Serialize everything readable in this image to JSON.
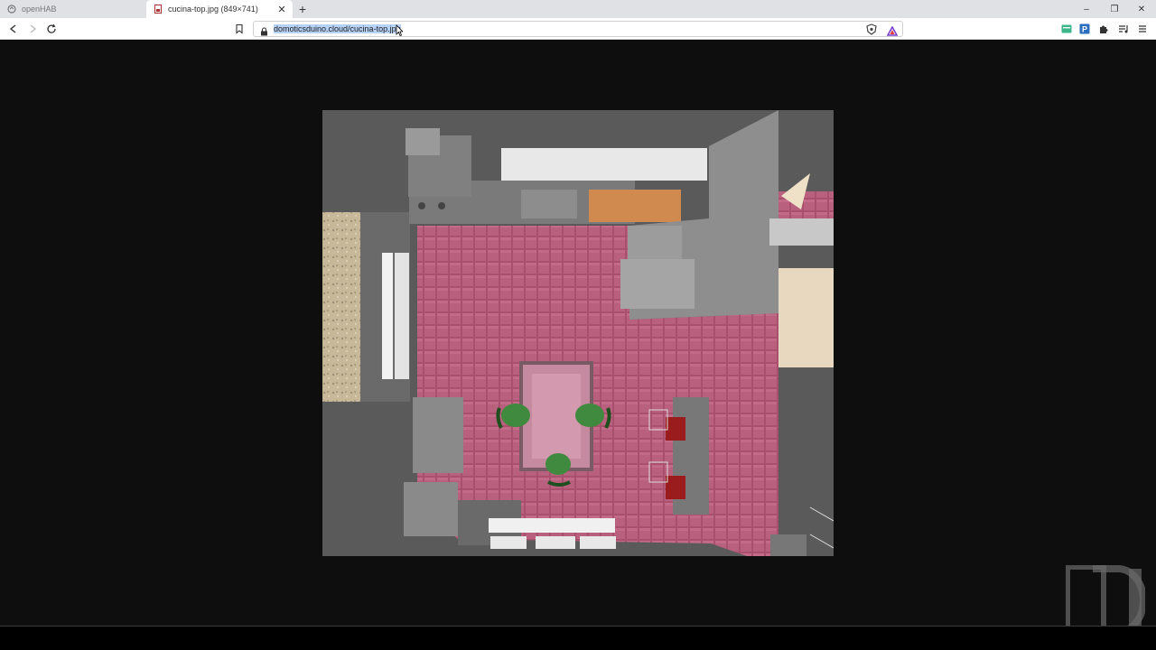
{
  "tabs": [
    {
      "title": "openHAB",
      "favicon": "openhab-icon",
      "active": false
    },
    {
      "title": "cucina-top.jpg (849×741)",
      "favicon": "image-file-icon",
      "active": true
    }
  ],
  "new_tab_label": "+",
  "window_controls": {
    "minimize": "–",
    "restore": "❐",
    "close": "✕"
  },
  "address_bar": {
    "url": "domoticsduino.cloud/cucina-top.jpg",
    "selected": true
  },
  "toolbar_icons": [
    "back-icon",
    "forward-icon",
    "reload-icon",
    "bookmark-icon",
    "lock-icon",
    "shield-icon",
    "rewards-icon",
    "extension-green-icon",
    "extension-blue-icon",
    "puzzle-icon",
    "media-queue-icon",
    "menu-icon"
  ],
  "image": {
    "name": "cucina-top.jpg",
    "natural_size": "849×741",
    "description_icon": "kitchen-3d-floorplan-image"
  },
  "colors": {
    "tab_strip": "#dfe1e5",
    "viewport_bg": "#0e0e0e",
    "selection": "#b6d2f7",
    "floor_tile": "#a8506e",
    "wood_counter": "#d08a50"
  }
}
